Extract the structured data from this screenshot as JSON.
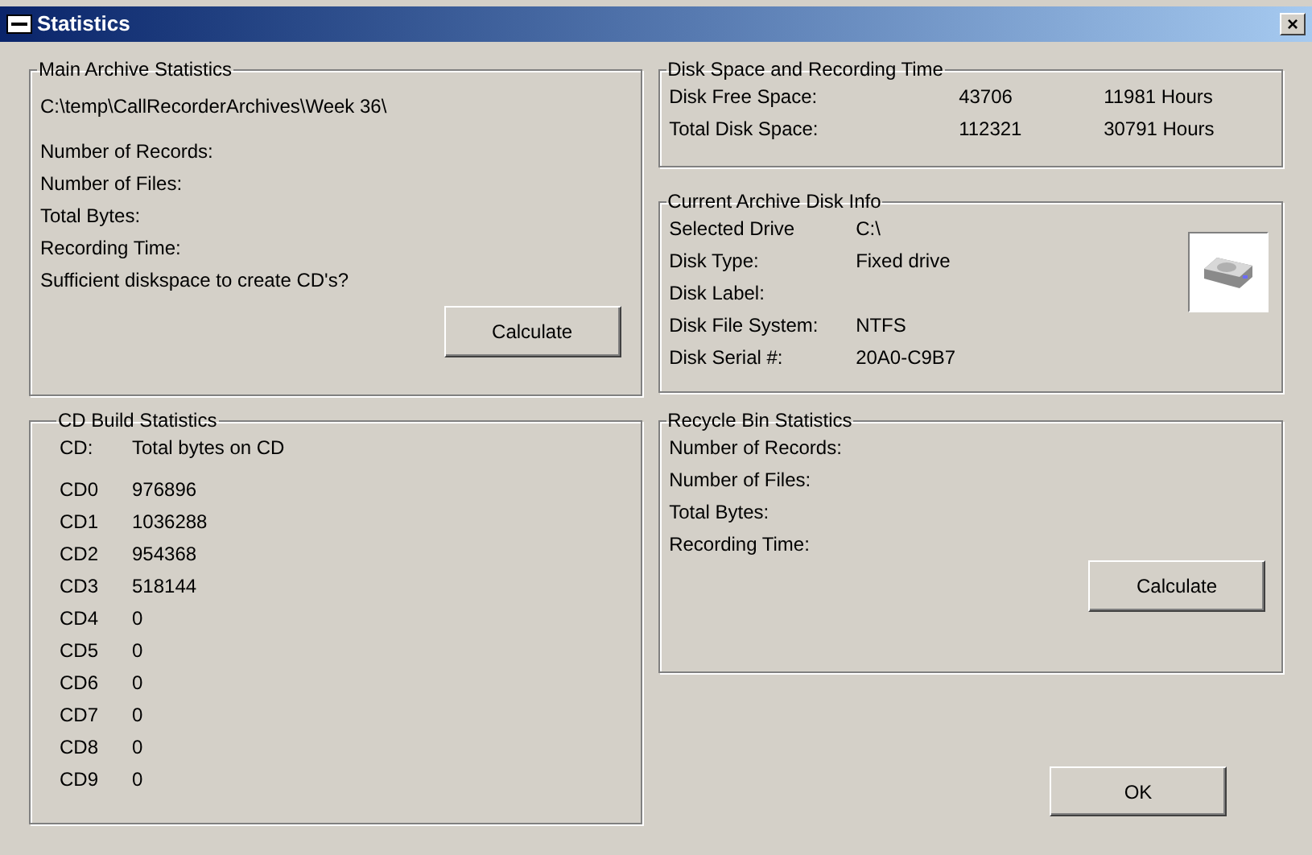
{
  "window": {
    "title": "Statistics",
    "close": "×"
  },
  "main_archive": {
    "title": "Main Archive Statistics",
    "path": "C:\\temp\\CallRecorderArchives\\Week 36\\",
    "labels": [
      "Number of Records:",
      "Number of Files:",
      "Total Bytes:",
      "Recording Time:",
      "Sufficient diskspace to create CD's?"
    ],
    "button": "Calculate"
  },
  "disk_space": {
    "title": "Disk Space and Recording Time",
    "rows": [
      {
        "label": "Disk Free Space:",
        "value": "43706",
        "hours": "11981 Hours"
      },
      {
        "label": "Total Disk Space:",
        "value": "112321",
        "hours": "30791 Hours"
      }
    ]
  },
  "disk_info": {
    "title": "Current Archive Disk Info",
    "rows": [
      {
        "label": "Selected Drive",
        "value": "C:\\"
      },
      {
        "label": "Disk Type:",
        "value": "Fixed drive"
      },
      {
        "label": "Disk Label:"
      },
      {
        "label": "Disk File System:",
        "value": "NTFS"
      },
      {
        "label": "Disk Serial #:",
        "value": "20A0-C9B7"
      }
    ]
  },
  "cd_build": {
    "title": "CD Build Statistics",
    "header": {
      "cd": "CD:",
      "bytes": "Total bytes on CD"
    },
    "rows": [
      {
        "cd": "CD0",
        "bytes": "976896"
      },
      {
        "cd": "CD1",
        "bytes": "1036288"
      },
      {
        "cd": "CD2",
        "bytes": "954368"
      },
      {
        "cd": "CD3",
        "bytes": "518144"
      },
      {
        "cd": "CD4",
        "bytes": "0"
      },
      {
        "cd": "CD5",
        "bytes": "0"
      },
      {
        "cd": "CD6",
        "bytes": "0"
      },
      {
        "cd": "CD7",
        "bytes": "0"
      },
      {
        "cd": "CD8",
        "bytes": "0"
      },
      {
        "cd": "CD9",
        "bytes": "0"
      }
    ]
  },
  "recycle_bin": {
    "title": "Recycle Bin Statistics",
    "labels": [
      "Number of Records:",
      "Number of Files:",
      "Total Bytes:",
      "Recording Time:"
    ],
    "button": "Calculate"
  },
  "buttons": [
    "OK"
  ]
}
